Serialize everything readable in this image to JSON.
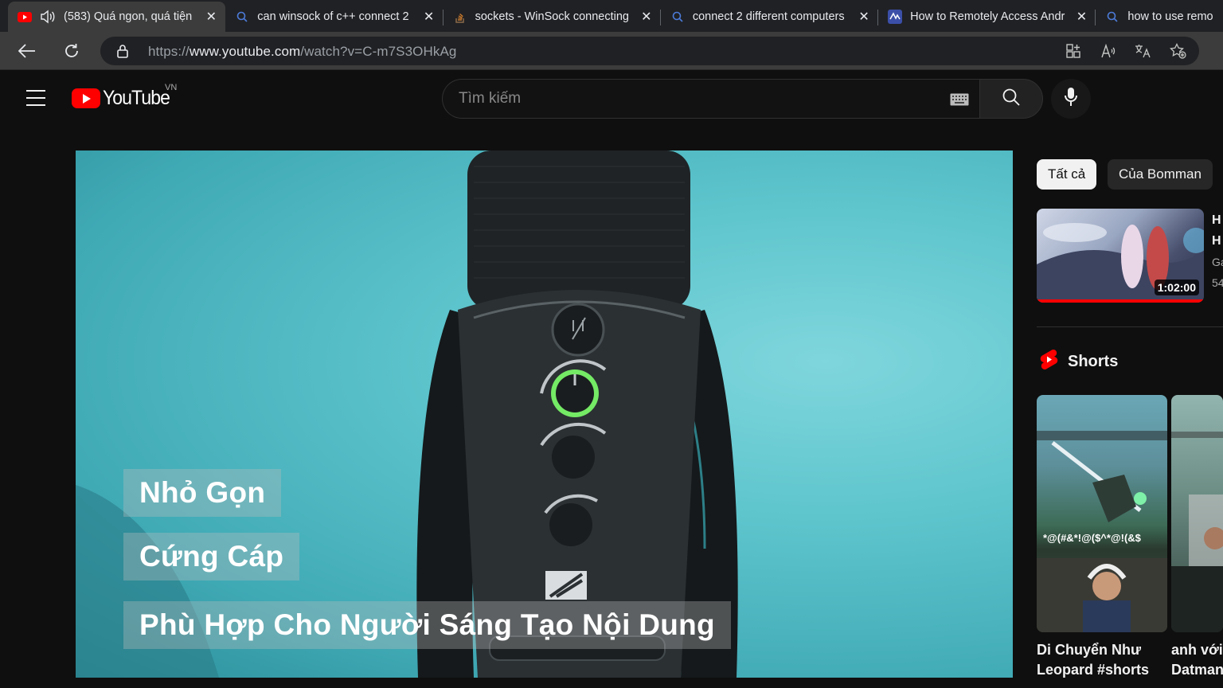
{
  "browser": {
    "tabs": [
      {
        "title": "(583) Quá ngon, quá tiện",
        "favicon": "youtube-icon",
        "active": true
      },
      {
        "title": "can winsock of c++ connect 2",
        "favicon": "search-icon",
        "active": false
      },
      {
        "title": "sockets - WinSock connecting",
        "favicon": "stackoverflow-icon",
        "active": false
      },
      {
        "title": "connect 2 different computers",
        "favicon": "search-icon",
        "active": false
      },
      {
        "title": "How to Remotely Access Andr",
        "favicon": "site-icon",
        "active": false
      },
      {
        "title": "how to use remo",
        "favicon": "search-icon",
        "active": false
      }
    ],
    "url_prefix": "https://",
    "url_host": "www.youtube.com",
    "url_path": "/watch?v=C-m7S3OHkAg"
  },
  "masthead": {
    "logo_text": "YouTube",
    "country_code": "VN",
    "search_placeholder": "Tìm kiếm"
  },
  "video": {
    "captions": [
      "Nhỏ Gọn",
      "Cứng Cáp",
      "Phù Hợp Cho Người Sáng Tạo Nội Dung"
    ]
  },
  "sidebar": {
    "chips": [
      "Tất cả",
      "Của Bomman"
    ],
    "recommended": [
      {
        "duration": "1:02:00",
        "title_lines": [
          "H",
          "H"
        ],
        "channel": "Ga",
        "meta": "54"
      }
    ],
    "shorts_heading": "Shorts",
    "shorts": [
      {
        "title_lines": [
          "Di Chuyển Như",
          "Leopard #shorts"
        ],
        "overlay_text": "*@(#&*!@($^*@!(&$"
      },
      {
        "title_lines": [
          "anh với",
          "Datmani"
        ]
      }
    ]
  },
  "colors": {
    "accent": "#ff0000",
    "background": "#0f0f0f",
    "video_bg": "#5ec5cd"
  }
}
